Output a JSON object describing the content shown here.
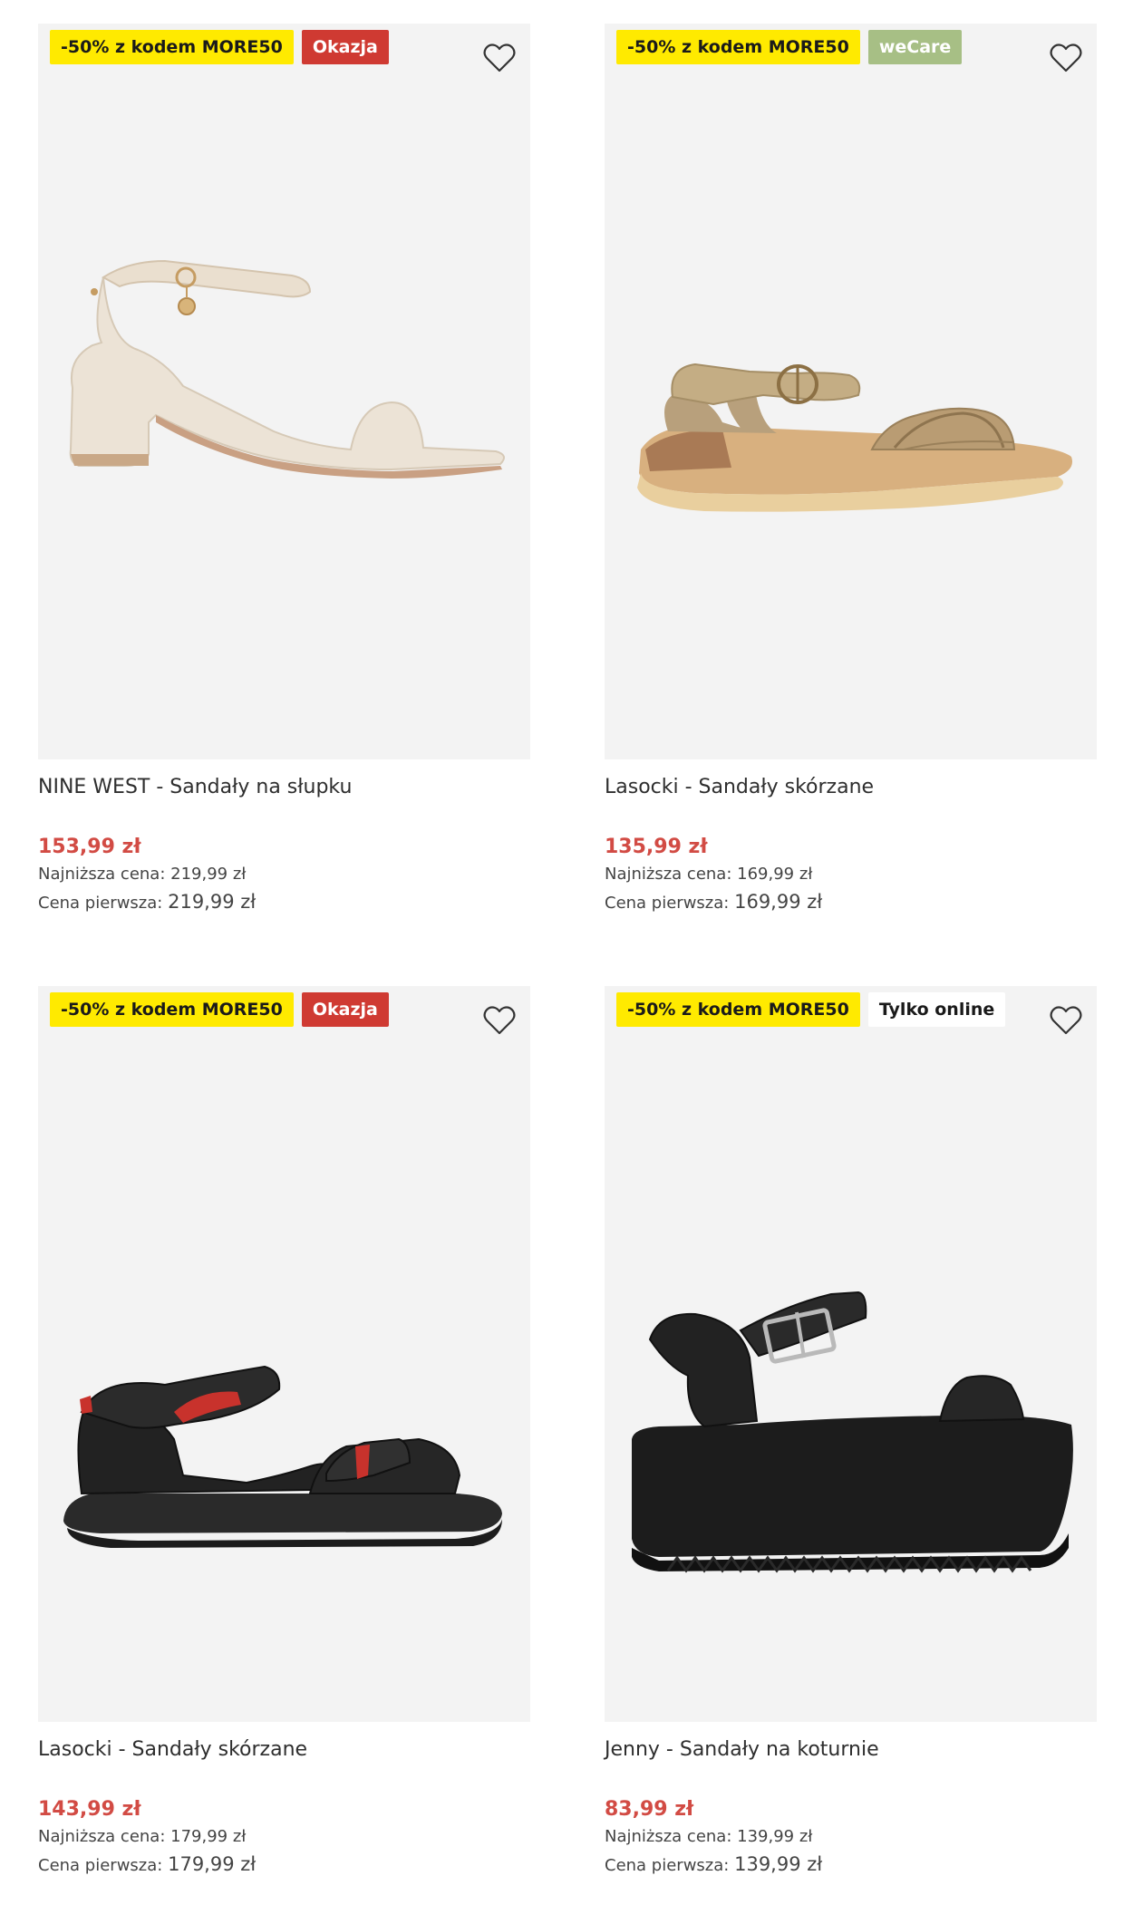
{
  "products": [
    {
      "badges": [
        {
          "label": "-50% z kodem MORE50",
          "type": "promo"
        },
        {
          "label": "Okazja",
          "type": "okazja"
        }
      ],
      "title": "NINE WEST - Sandały na słupku",
      "price": "153,99 zł",
      "lowest_label": "Najniższa cena:",
      "lowest_value": "219,99 zł",
      "original_label": "Cena pierwsza:",
      "original_value": "219,99 zł",
      "image": "cream-block-heel-sandal",
      "wishlist_icon": "heart-outline-icon"
    },
    {
      "badges": [
        {
          "label": "-50% z kodem MORE50",
          "type": "promo"
        },
        {
          "label": "weCare",
          "type": "wecare"
        }
      ],
      "title": "Lasocki - Sandały skórzane",
      "price": "135,99 zł",
      "lowest_label": "Najniższa cena:",
      "lowest_value": "169,99 zł",
      "original_label": "Cena pierwsza:",
      "original_value": "169,99 zł",
      "image": "gold-wedge-sandal",
      "wishlist_icon": "heart-outline-icon"
    },
    {
      "badges": [
        {
          "label": "-50% z kodem MORE50",
          "type": "promo"
        },
        {
          "label": "Okazja",
          "type": "okazja"
        }
      ],
      "title": "Lasocki - Sandały skórzane",
      "price": "143,99 zł",
      "lowest_label": "Najniższa cena:",
      "lowest_value": "179,99 zł",
      "original_label": "Cena pierwsza:",
      "original_value": "179,99 zł",
      "image": "black-velcro-sandal",
      "wishlist_icon": "heart-outline-icon"
    },
    {
      "badges": [
        {
          "label": "-50% z kodem MORE50",
          "type": "promo"
        },
        {
          "label": "Tylko online",
          "type": "online"
        }
      ],
      "title": "Jenny - Sandały na koturnie",
      "price": "83,99 zł",
      "lowest_label": "Najniższa cena:",
      "lowest_value": "139,99 zł",
      "original_label": "Cena pierwsza:",
      "original_value": "139,99 zł",
      "image": "black-platform-sandal",
      "wishlist_icon": "heart-outline-icon"
    }
  ],
  "colors": {
    "promo_badge": "#ffea00",
    "okazja_badge": "#cf3a32",
    "wecare_badge": "#a7bf85",
    "price": "#d24b44",
    "image_bg": "#f3f3f3"
  }
}
